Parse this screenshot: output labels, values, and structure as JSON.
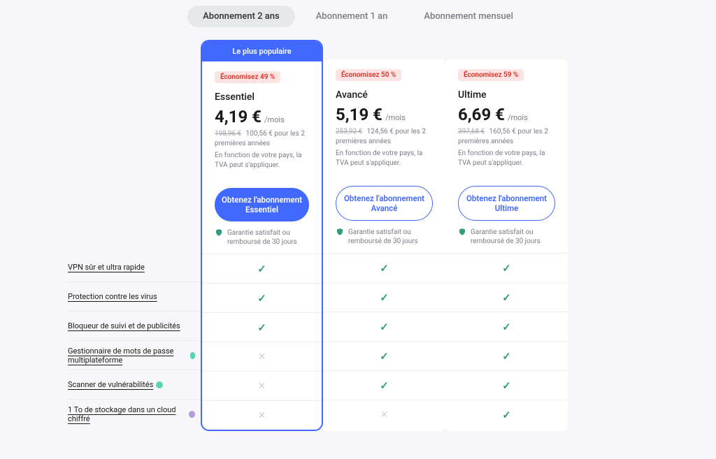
{
  "tabs": [
    "Abonnement 2 ans",
    "Abonnement 1 an",
    "Abonnement mensuel"
  ],
  "active_tab": 0,
  "popular_label": "Le plus populaire",
  "guarantee_text": "Garantie satisfait ou remboursé de 30 jours",
  "per_month": "/mois",
  "vat_note": "En fonction de votre pays, la TVA peut s'appliquer.",
  "plans": [
    {
      "id": "essentiel",
      "save": "Économisez 49 %",
      "name": "Essentiel",
      "price": "4,19 €",
      "strike": "198,96 €",
      "total": "100,56 € pour les 2 premières années",
      "cta": "Obtenez l'abonnement Essentiel",
      "popular": true
    },
    {
      "id": "avance",
      "save": "Économisez 50 %",
      "name": "Avancé",
      "price": "5,19 €",
      "strike": "253,92 €",
      "total": "124,56 € pour les 2 premières années",
      "cta": "Obtenez l'abonnement Avancé",
      "popular": false
    },
    {
      "id": "ultime",
      "save": "Économisez 59 %",
      "name": "Ultime",
      "price": "6,69 €",
      "strike": "397,68 €",
      "total": "160,56 € pour les 2 premières années",
      "cta": "Obtenez l'abonnement Ultime",
      "popular": false
    }
  ],
  "features": [
    {
      "label": "VPN sûr et ultra rapide",
      "badge": "",
      "cells": [
        true,
        true,
        true
      ]
    },
    {
      "label": "Protection contre les virus",
      "badge": "",
      "cells": [
        true,
        true,
        true
      ]
    },
    {
      "label": "Bloqueur de suivi et de publicités",
      "badge": "",
      "cells": [
        true,
        true,
        true
      ]
    },
    {
      "label": "Gestionnaire de mots de passe multiplateforme",
      "badge": "teal",
      "cells": [
        false,
        true,
        true
      ]
    },
    {
      "label": "Scanner de vulnérabilités",
      "badge": "teal",
      "cells": [
        false,
        true,
        true
      ]
    },
    {
      "label": "1 To de stockage dans un cloud chiffré",
      "badge": "purple",
      "cells": [
        false,
        false,
        true
      ]
    }
  ]
}
